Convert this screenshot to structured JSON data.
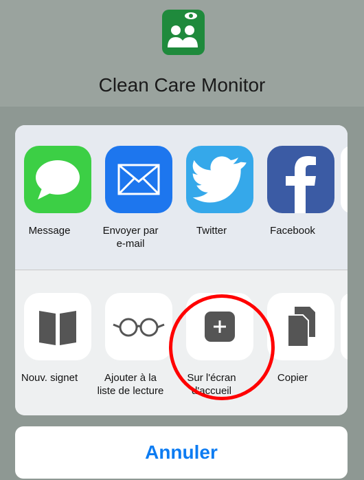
{
  "app": {
    "title": "Clean Care Monitor",
    "icon_name": "clean-care-monitor-logo",
    "accent": "#1f8a3c"
  },
  "share_sheet": {
    "apps": [
      {
        "label": "Message",
        "icon": "messages-icon"
      },
      {
        "label": "Envoyer par\ne-mail",
        "icon": "mail-icon"
      },
      {
        "label": "Twitter",
        "icon": "twitter-icon"
      },
      {
        "label": "Facebook",
        "icon": "facebook-icon"
      }
    ],
    "actions": [
      {
        "label": "Nouv. signet",
        "icon": "bookmark-icon"
      },
      {
        "label": "Ajouter à la\nliste de lecture",
        "icon": "reading-list-icon"
      },
      {
        "label": "Sur l'écran\nd'accueil",
        "icon": "add-to-home-icon"
      },
      {
        "label": "Copier",
        "icon": "copy-icon"
      }
    ]
  },
  "cancel_label": "Annuler",
  "colors": {
    "cancel_text": "#0d7cf2",
    "highlight": "#ff0000"
  }
}
